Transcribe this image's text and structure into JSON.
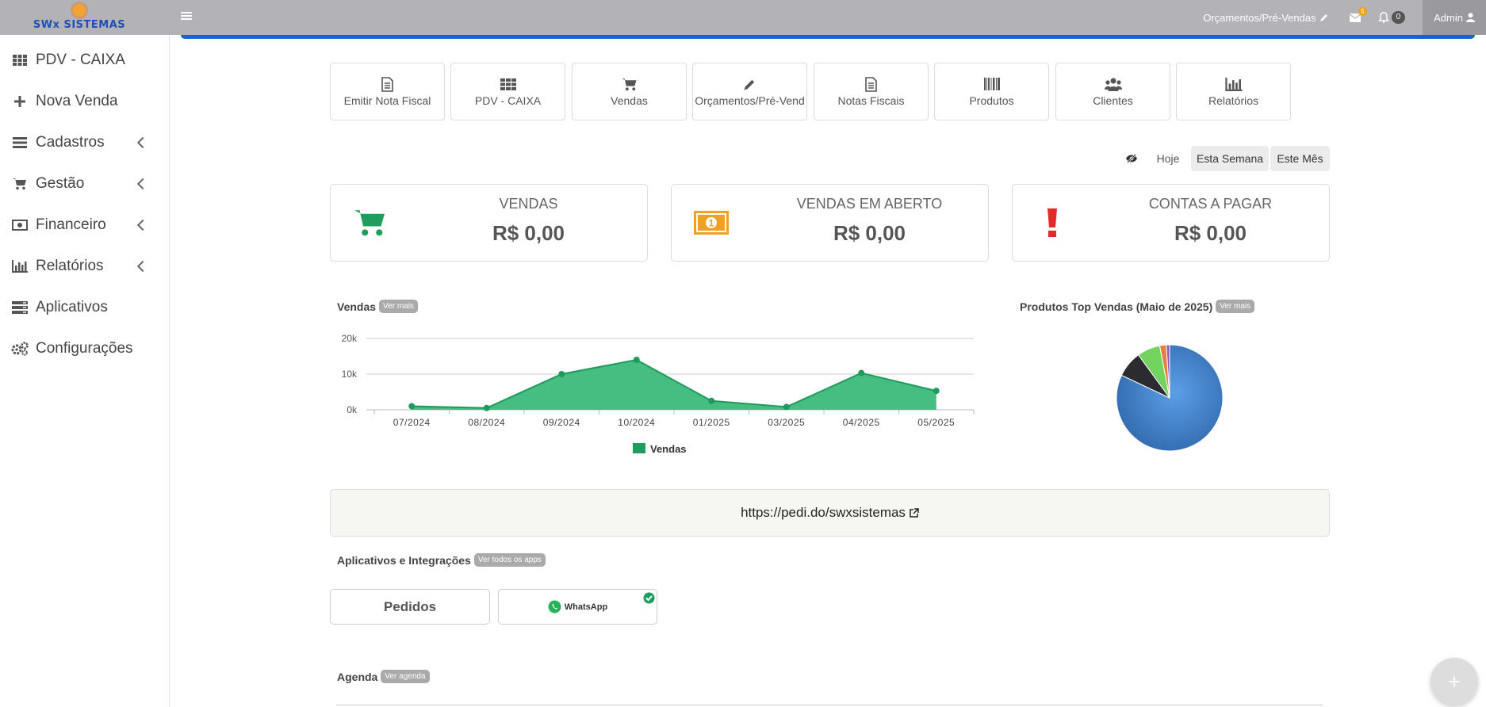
{
  "brand": {
    "name": "SWx SISTEMAS"
  },
  "topbar": {
    "orcamentos_link": "Orçamentos/Pré-Vendas",
    "messages_badge": "5",
    "notifications_count": "0",
    "user": "Admin"
  },
  "sidebar": {
    "items": [
      {
        "label": "PDV - CAIXA",
        "icon": "grid-icon",
        "submenu": false
      },
      {
        "label": "Nova Venda",
        "icon": "plus-icon",
        "submenu": false
      },
      {
        "label": "Cadastros",
        "icon": "list-icon",
        "submenu": true
      },
      {
        "label": "Gestão",
        "icon": "cart-icon",
        "submenu": true
      },
      {
        "label": "Financeiro",
        "icon": "money-icon",
        "submenu": true
      },
      {
        "label": "Relatórios",
        "icon": "bar-chart-icon",
        "submenu": true
      },
      {
        "label": "Aplicativos",
        "icon": "server-icon",
        "submenu": false
      },
      {
        "label": "Configurações",
        "icon": "cogs-icon",
        "submenu": false
      }
    ]
  },
  "quick_access": [
    {
      "label": "Emitir Nota Fiscal",
      "icon": "file-icon"
    },
    {
      "label": "PDV - CAIXA",
      "icon": "grid-icon"
    },
    {
      "label": "Vendas",
      "icon": "cart-icon"
    },
    {
      "label": "Orçamentos/Pré-Vend",
      "icon": "pencil-icon"
    },
    {
      "label": "Notas Fiscais",
      "icon": "file-icon"
    },
    {
      "label": "Produtos",
      "icon": "barcode-icon"
    },
    {
      "label": "Clientes",
      "icon": "users-icon"
    },
    {
      "label": "Relatórios",
      "icon": "bar-chart-icon"
    }
  ],
  "period_filter": {
    "today": "Hoje",
    "week": "Esta Semana",
    "month": "Este Mês",
    "selected": [
      "Esta Semana",
      "Este Mês"
    ]
  },
  "cards": [
    {
      "label": "VENDAS",
      "value": "R$ 0,00",
      "icon": "cart-icon",
      "color": "#1e9e5e"
    },
    {
      "label": "VENDAS EM ABERTO",
      "value": "R$ 0,00",
      "icon": "money-icon",
      "color": "#f2a024"
    },
    {
      "label": "CONTAS A PAGAR",
      "value": "R$ 0,00",
      "icon": "exclamation-icon",
      "color": "#e12a2a"
    }
  ],
  "sales_chart": {
    "title": "Vendas",
    "more": "Ver mais"
  },
  "pie_chart": {
    "title": "Produtos Top Vendas (Maio de 2025)",
    "more": "Ver mais"
  },
  "chart_data": [
    {
      "type": "area",
      "title": "Vendas",
      "categories": [
        "07/2024",
        "08/2024",
        "09/2024",
        "10/2024",
        "01/2025",
        "03/2025",
        "04/2025",
        "05/2025"
      ],
      "y_ticks": [
        "0k",
        "10k",
        "20k"
      ],
      "ylim": [
        0,
        20000
      ],
      "series": [
        {
          "name": "Vendas",
          "values": [
            1000,
            500,
            10000,
            14000,
            2500,
            800,
            10300,
            5300
          ]
        }
      ],
      "legend_position": "bottom",
      "color": "#3dbb7a",
      "grid": true
    },
    {
      "type": "pie",
      "title": "Produtos Top Vendas (Maio de 2025)",
      "values": [
        82,
        8,
        7,
        2,
        1
      ],
      "colors": [
        "#3f7fc9",
        "#2b2b30",
        "#72d35e",
        "#e58040",
        "#8a5cc6"
      ]
    }
  ],
  "store_link": {
    "url": "https://pedi.do/swxsistemas"
  },
  "apps": {
    "title": "Aplicativos e Integrações",
    "more": "Ver todos os apps",
    "items": [
      {
        "label": "Pedidos",
        "active": false
      },
      {
        "label": "WhatsApp",
        "active": true
      }
    ]
  },
  "agenda": {
    "title": "Agenda",
    "more": "Ver agenda"
  },
  "fab": {
    "label": "+"
  }
}
